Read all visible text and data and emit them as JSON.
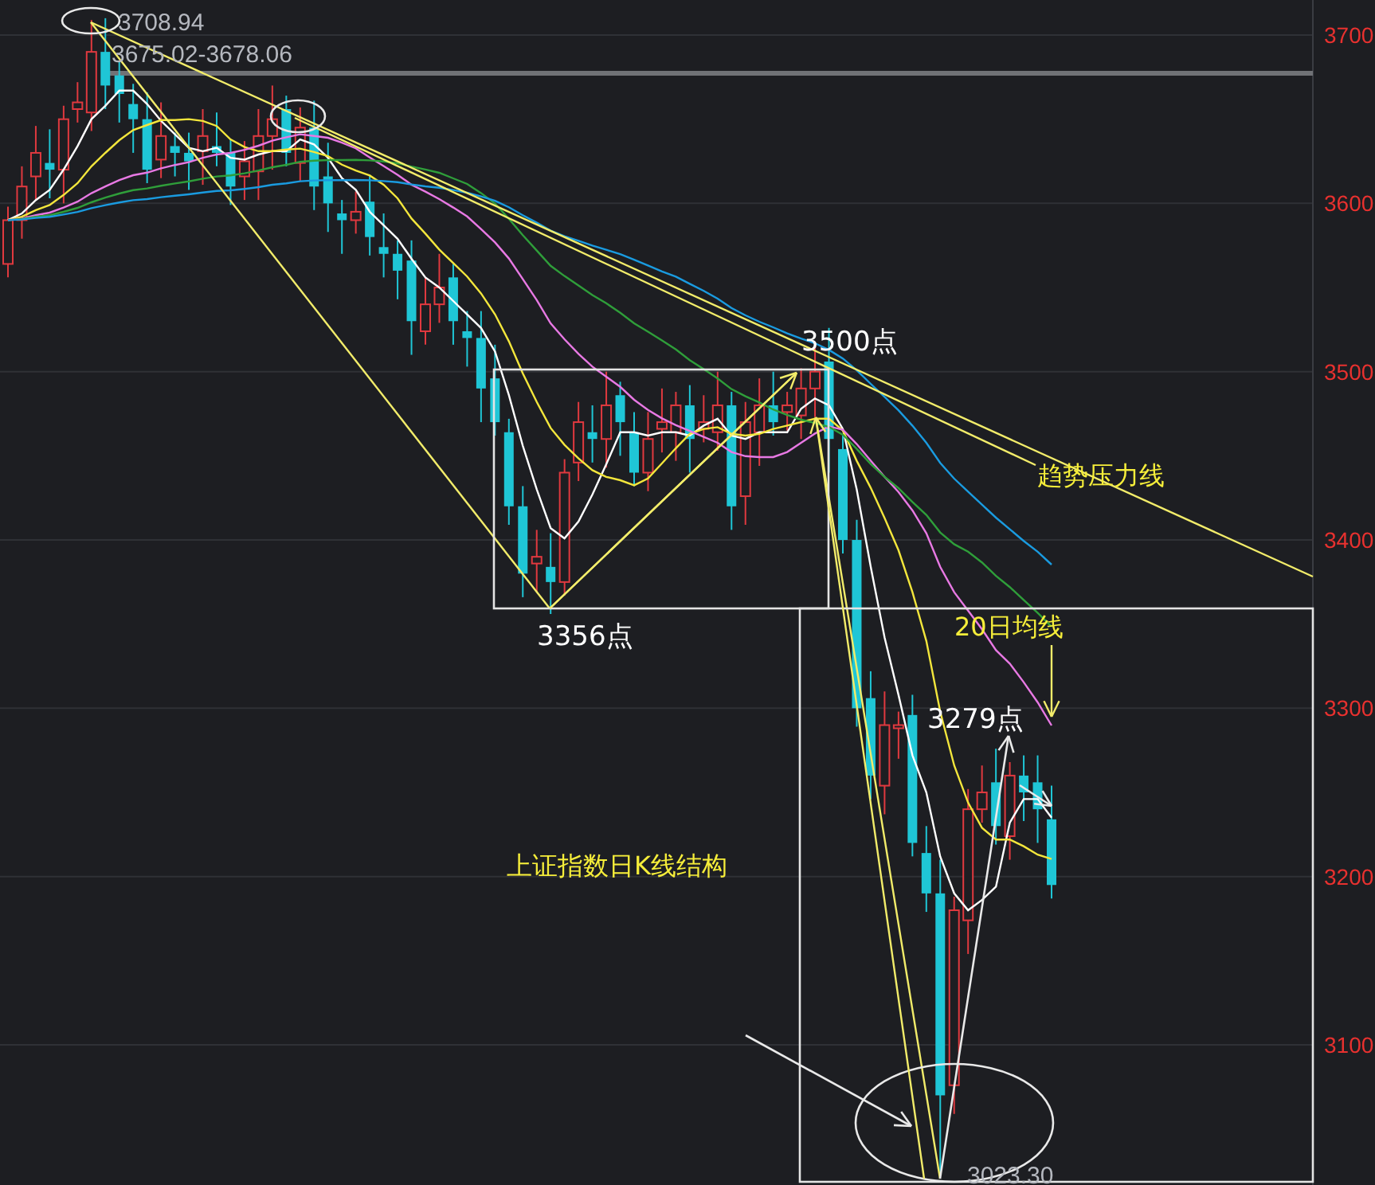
{
  "price_axis": {
    "labels": [
      "3700",
      "3600",
      "3500",
      "3400",
      "3300",
      "3200",
      "3100"
    ]
  },
  "annotations": [
    {
      "text": "3708.94",
      "kind": "price"
    },
    {
      "text": "3675.02-3678.06",
      "kind": "price"
    },
    {
      "text": "3500点",
      "kind": "point"
    },
    {
      "text": "趋势压力线",
      "kind": "note"
    },
    {
      "text": "3356点",
      "kind": "point"
    },
    {
      "text": "20日均线",
      "kind": "note"
    },
    {
      "text": "3279点",
      "kind": "point"
    },
    {
      "text": "上证指数日K线结构",
      "kind": "note"
    },
    {
      "text": "3023.30",
      "kind": "price"
    }
  ]
}
